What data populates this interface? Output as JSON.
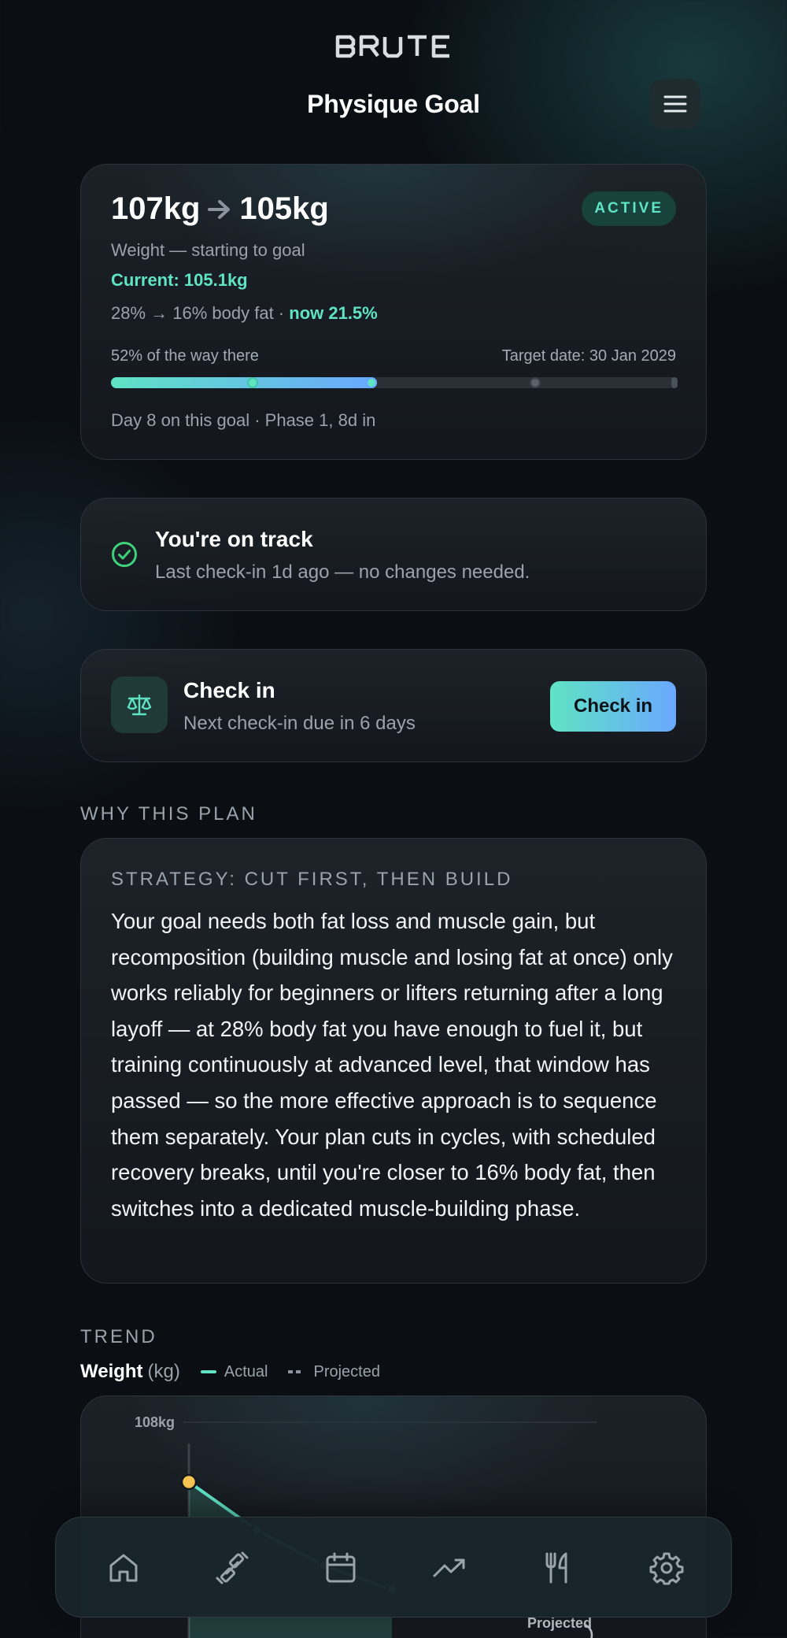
{
  "app": {
    "logo_text": "BRUTE",
    "title": "Physique Goal"
  },
  "colors": {
    "accent": "#5fe3c4",
    "accent_blue": "#6aa8ff",
    "background": "#0b0f14",
    "highlight_point": "#f5c451"
  },
  "goal": {
    "start_weight": "107kg",
    "target_weight": "105kg",
    "status_badge": "ACTIVE",
    "weight_caption": "Weight — starting to goal",
    "current": "Current: 105.1kg",
    "body_fat_range": "28% → 16% body fat ·",
    "body_fat_now": "now 21.5%",
    "progress_text": "52% of the way there",
    "progress_fraction": 0.47,
    "target_date": "Target date: 30 Jan 2029",
    "footer": "Day 8 on this goal · Phase 1, 8d in"
  },
  "track": {
    "icon": "check-circle-icon",
    "title": "You're on track",
    "subtitle": "Last check-in 1d ago — no changes needed."
  },
  "checkin": {
    "icon": "scale-icon",
    "title": "Check in",
    "subtitle": "Next check-in due in 6 days",
    "button_label": "Check in"
  },
  "why": {
    "section_label": "WHY THIS PLAN",
    "strategy": "STRATEGY: CUT FIRST, THEN BUILD",
    "body": "Your goal needs both fat loss and muscle gain, but recomposition (building muscle and losing fat at once) only works reliably for beginners or lifters returning after a long layoff — at 28% body fat you have enough to fuel it, but training continuously at advanced level, that window has passed — so the more effective approach is to sequence them separately. Your plan cuts in cycles, with scheduled recovery breaks, until you're closer to 16% body fat, then switches into a dedicated muscle-building phase."
  },
  "trend": {
    "section_label": "TREND",
    "metric": "Weight",
    "unit": "(kg)",
    "legend_actual": "Actual",
    "legend_projected": "Projected"
  },
  "chart_data": {
    "type": "line",
    "y_tick_labels": [
      "108kg"
    ],
    "annotation": "Projected",
    "series": [
      {
        "name": "Actual",
        "values": [
          107.5,
          107.1,
          106.8,
          106.6
        ]
      }
    ],
    "ylim": [
      104,
      108
    ],
    "grid": true
  },
  "nav": {
    "items": [
      {
        "icon": "home-icon"
      },
      {
        "icon": "dumbbell-icon"
      },
      {
        "icon": "calendar-icon"
      },
      {
        "icon": "trend-icon"
      },
      {
        "icon": "fork-knife-icon"
      },
      {
        "icon": "gear-icon"
      }
    ]
  }
}
